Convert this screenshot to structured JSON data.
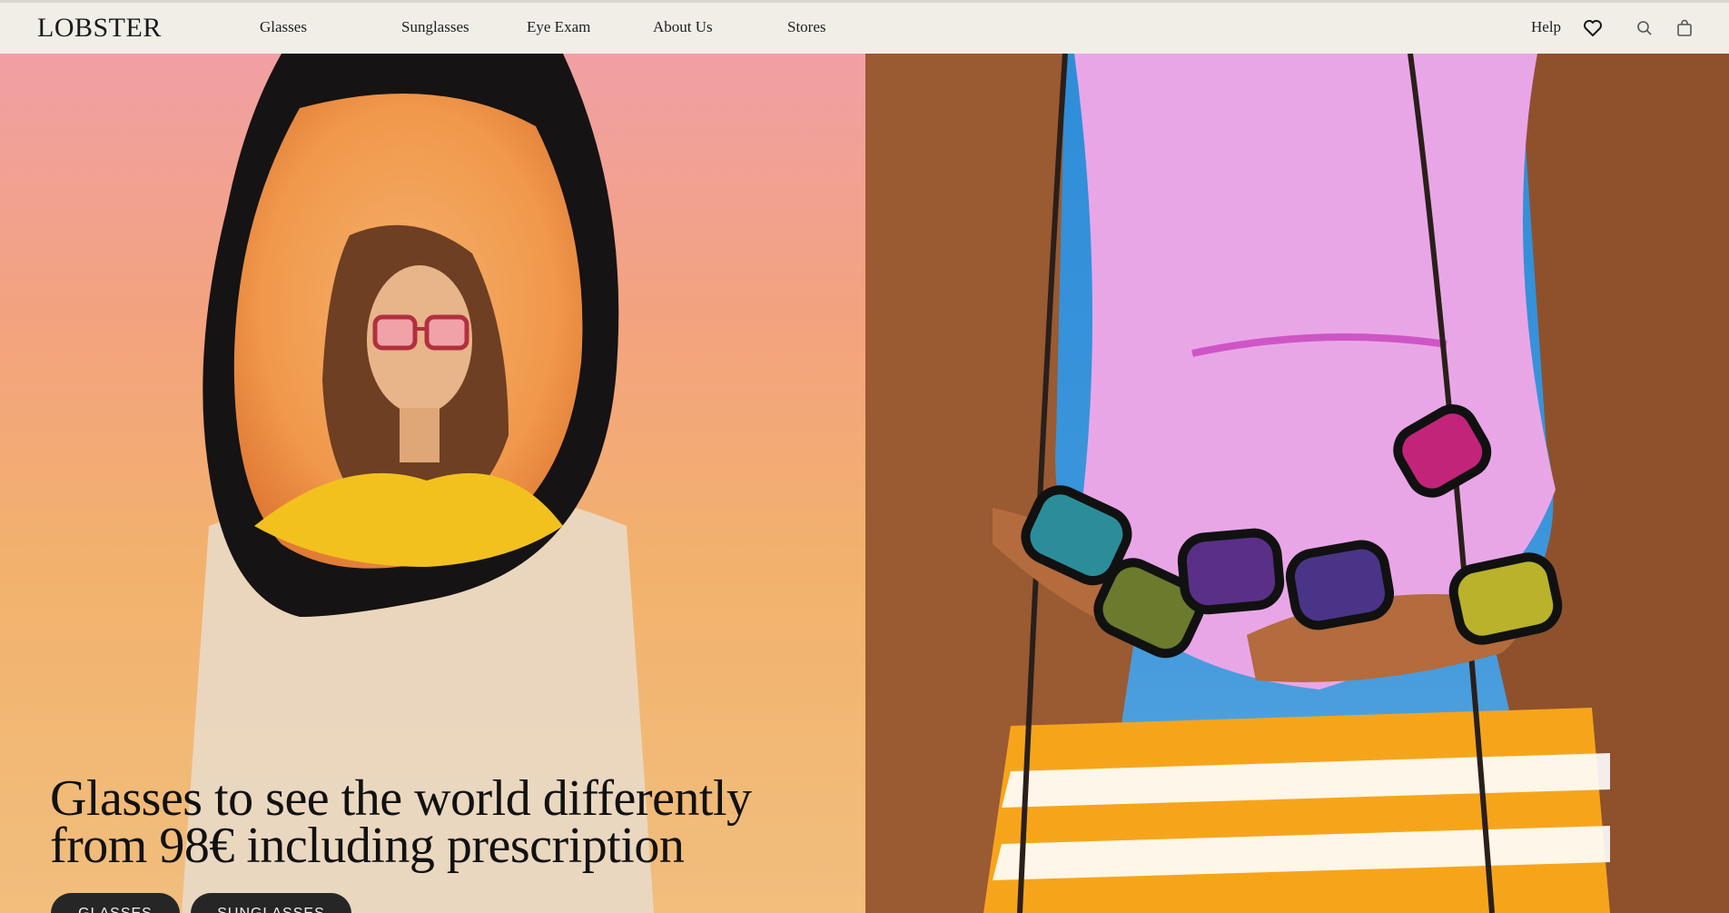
{
  "header": {
    "logo": "LOBSTER",
    "nav": [
      "Glasses",
      "Sunglasses",
      "Eye Exam",
      "About Us",
      "Stores"
    ],
    "help": "Help",
    "icons": [
      "heart-icon",
      "search-icon",
      "bag-icon"
    ]
  },
  "hero": {
    "headline_line1": "Glasses to see the world differently",
    "headline_line2": "from 98€ including prescription",
    "buttons": [
      "GLASSES",
      "SUNGLASSES"
    ]
  }
}
